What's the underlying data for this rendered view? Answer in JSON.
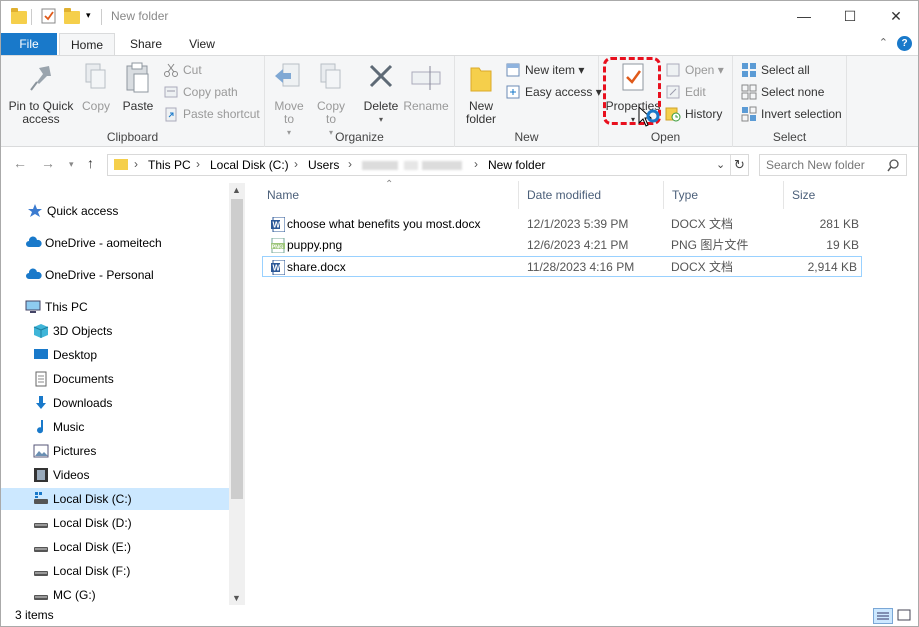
{
  "window": {
    "title": "New folder"
  },
  "tabs": {
    "file": "File",
    "home": "Home",
    "share": "Share",
    "view": "View"
  },
  "ribbon": {
    "clipboard": {
      "label": "Clipboard",
      "pin": "Pin to Quick access",
      "copy": "Copy",
      "paste": "Paste",
      "cut": "Cut",
      "copy_path": "Copy path",
      "paste_shortcut": "Paste shortcut"
    },
    "organize": {
      "label": "Organize",
      "move_to": "Move to",
      "copy_to": "Copy to",
      "delete": "Delete",
      "rename": "Rename"
    },
    "new": {
      "label": "New",
      "new_folder": "New folder",
      "new_item": "New item",
      "easy_access": "Easy access"
    },
    "open": {
      "label": "Open",
      "properties": "Properties",
      "open": "Open",
      "edit": "Edit",
      "history": "History"
    },
    "select": {
      "label": "Select",
      "select_all": "Select all",
      "select_none": "Select none",
      "invert": "Invert selection"
    }
  },
  "address": {
    "crumbs": [
      "This PC",
      "Local Disk (C:)",
      "Users",
      "New folder"
    ]
  },
  "search": {
    "placeholder": "Search New folder"
  },
  "nav": [
    {
      "label": "Quick access",
      "icon": "star-icon"
    },
    {
      "label": "OneDrive - aomeitech",
      "icon": "cloud-icon"
    },
    {
      "label": "OneDrive - Personal",
      "icon": "cloud-icon"
    },
    {
      "label": "This PC",
      "icon": "computer-icon"
    },
    {
      "label": "3D Objects",
      "icon": "cube-icon"
    },
    {
      "label": "Desktop",
      "icon": "desktop-icon"
    },
    {
      "label": "Documents",
      "icon": "documents-icon"
    },
    {
      "label": "Downloads",
      "icon": "download-icon"
    },
    {
      "label": "Music",
      "icon": "music-icon"
    },
    {
      "label": "Pictures",
      "icon": "pictures-icon"
    },
    {
      "label": "Videos",
      "icon": "videos-icon"
    },
    {
      "label": "Local Disk (C:)",
      "icon": "drive-icon"
    },
    {
      "label": "Local Disk (D:)",
      "icon": "drive-icon"
    },
    {
      "label": "Local Disk (E:)",
      "icon": "drive-icon"
    },
    {
      "label": "Local Disk (F:)",
      "icon": "drive-icon"
    },
    {
      "label": "MC (G:)",
      "icon": "drive-icon"
    }
  ],
  "columns": {
    "name": "Name",
    "date": "Date modified",
    "type": "Type",
    "size": "Size"
  },
  "files": [
    {
      "name": "choose what benefits you most.docx",
      "date": "12/1/2023 5:39 PM",
      "type": "DOCX 文档",
      "size": "281 KB",
      "icon": "word-doc-icon"
    },
    {
      "name": "puppy.png",
      "date": "12/6/2023 4:21 PM",
      "type": "PNG 图片文件",
      "size": "19 KB",
      "icon": "png-file-icon"
    },
    {
      "name": "share.docx",
      "date": "11/28/2023 4:16 PM",
      "type": "DOCX 文档",
      "size": "2,914 KB",
      "icon": "word-doc-icon"
    }
  ],
  "status": {
    "items": "3 items"
  },
  "colors": {
    "accent": "#1979ca",
    "selection": "#cce8ff",
    "highlight": "#e8101e"
  }
}
